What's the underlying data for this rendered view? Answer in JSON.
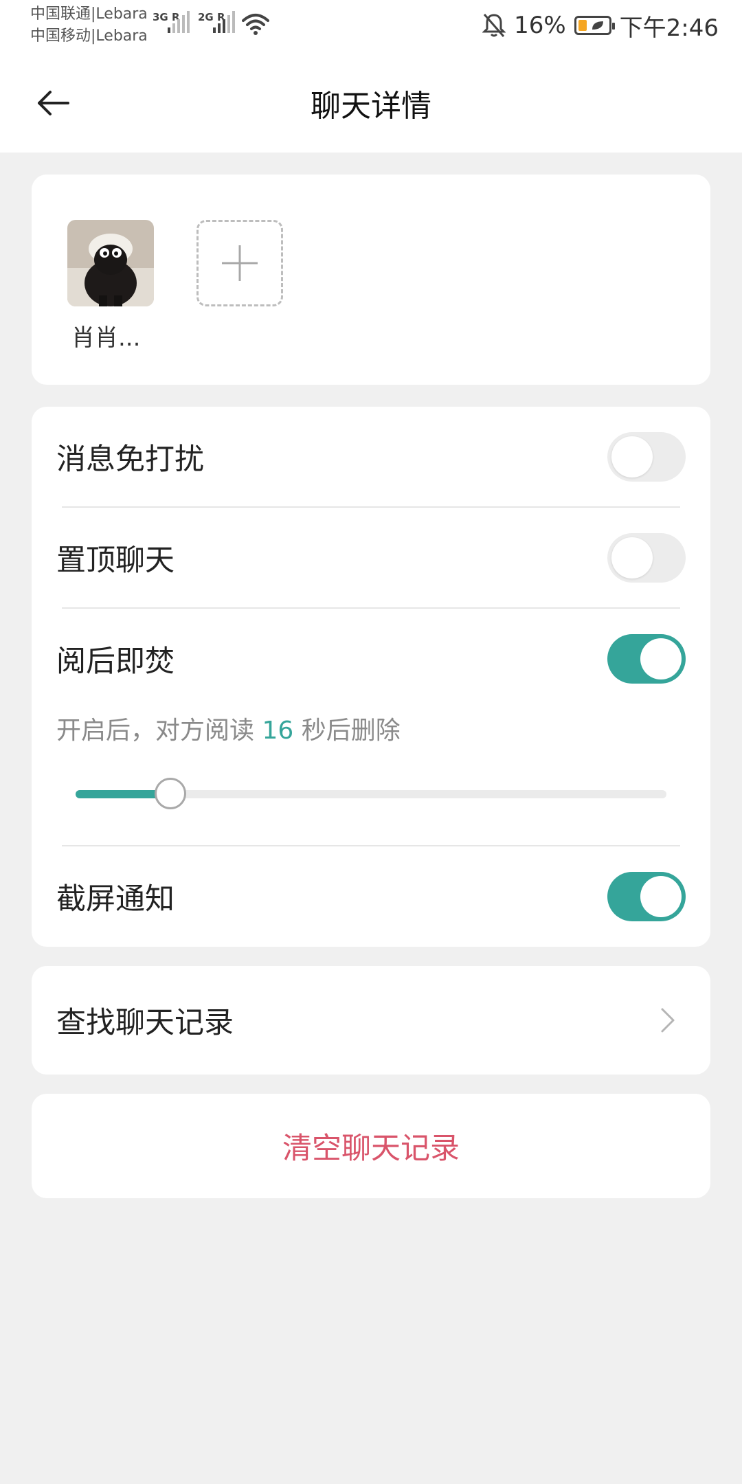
{
  "status_bar": {
    "carrier_1": "中国联通|Lebara",
    "carrier_2": "中国移动|Lebara",
    "signal_1_tag": "3G R",
    "signal_2_tag": "2G R",
    "battery_percent": "16%",
    "time": "下午2:46",
    "icons": [
      "signal-icon",
      "wifi-icon",
      "bell-off-icon",
      "battery-icon"
    ]
  },
  "header": {
    "title": "聊天详情",
    "back_icon": "arrow-left-icon"
  },
  "members": {
    "items": [
      {
        "name": "肖肖..."
      }
    ],
    "add_icon": "plus-icon"
  },
  "settings": {
    "mute_label": "消息免打扰",
    "mute_on": false,
    "pin_label": "置顶聊天",
    "pin_on": false,
    "burn_label": "阅后即焚",
    "burn_on": true,
    "burn_note_prefix": "开启后，对方阅读",
    "burn_seconds": "16",
    "burn_note_suffix": "秒后删除",
    "burn_slider_fraction": 0.16,
    "screenshot_label": "截屏通知",
    "screenshot_on": true
  },
  "search": {
    "label": "查找聊天记录",
    "chevron_icon": "chevron-right-icon"
  },
  "clear": {
    "label": "清空聊天记录"
  },
  "colors": {
    "accent": "#35a59a",
    "danger": "#d9546a",
    "background": "#f0f0f0",
    "battery_low": "#f5a623"
  }
}
